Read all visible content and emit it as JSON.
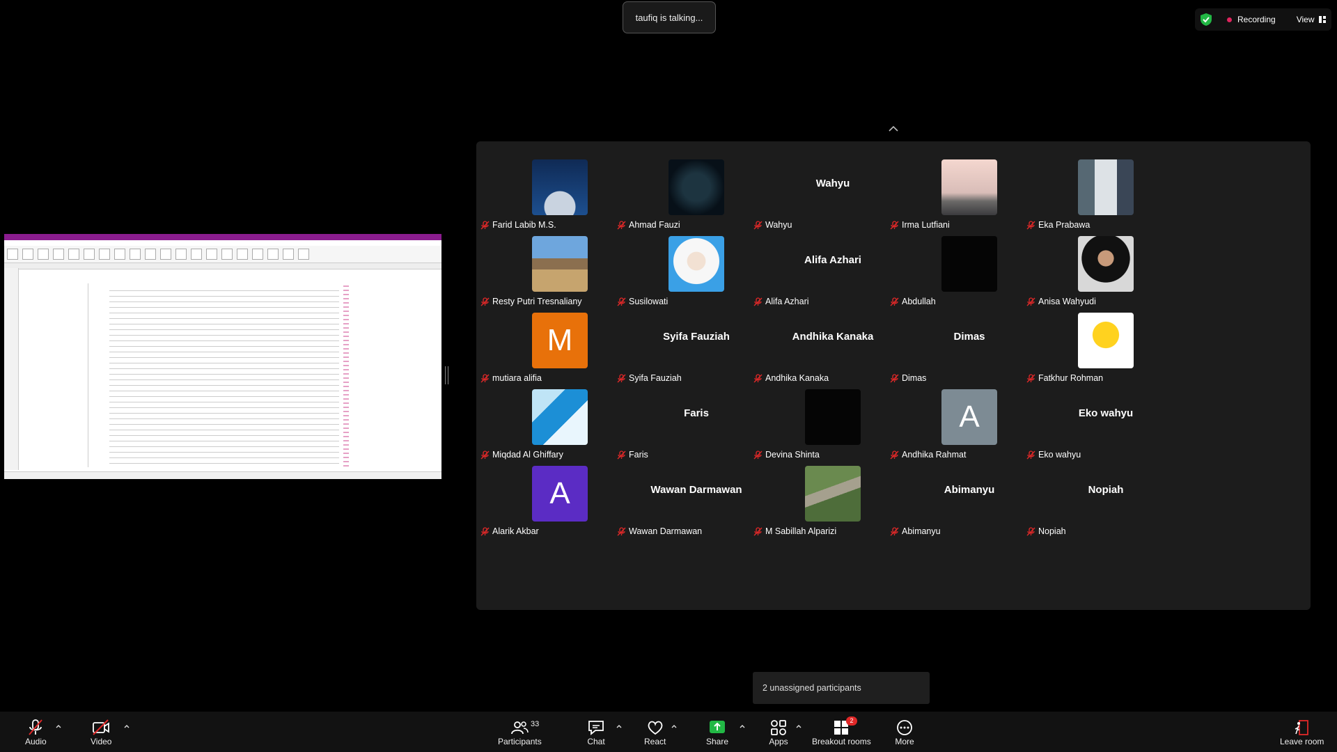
{
  "talking": "taufiq is talking...",
  "recording": {
    "label": "Recording",
    "view": "View"
  },
  "gallery": {
    "tiles": [
      {
        "name": "Farid Labib M.S.",
        "avatar": "photo-moon",
        "big": ""
      },
      {
        "name": "Ahmad Fauzi",
        "avatar": "photo-anime",
        "big": ""
      },
      {
        "name": "Wahyu",
        "avatar": "",
        "big": "Wahyu"
      },
      {
        "name": "Irma Lutfiani",
        "avatar": "photo-sky",
        "big": ""
      },
      {
        "name": "Eka Prabawa",
        "avatar": "photo-worker",
        "big": ""
      },
      {
        "name": "Resty Putri Tresnaliany",
        "avatar": "photo-field",
        "big": ""
      },
      {
        "name": "Susilowati",
        "avatar": "photo-hijab",
        "big": ""
      },
      {
        "name": "Alifa Azhari",
        "avatar": "",
        "big": "Alifa Azhari"
      },
      {
        "name": "Abdullah",
        "avatar": "photo-dark",
        "big": ""
      },
      {
        "name": "Anisa Wahyudi",
        "avatar": "photo-hijab-dark",
        "big": ""
      },
      {
        "name": "mutiara alifia",
        "avatar": "letter",
        "letter": "M",
        "color": "#e8710a",
        "big": ""
      },
      {
        "name": "Syifa Fauziah",
        "avatar": "",
        "big": "Syifa Fauziah"
      },
      {
        "name": "Andhika Kanaka",
        "avatar": "",
        "big": "Andhika Kanaka"
      },
      {
        "name": "Dimas",
        "avatar": "",
        "big": "Dimas"
      },
      {
        "name": "Fatkhur Rohman",
        "avatar": "photo-emoji",
        "big": ""
      },
      {
        "name": "Miqdad Al Ghiffary",
        "avatar": "photo-blue",
        "big": ""
      },
      {
        "name": "Faris",
        "avatar": "",
        "big": "Faris"
      },
      {
        "name": "Devina Shinta",
        "avatar": "photo-dark",
        "big": ""
      },
      {
        "name": "Andhika Rahmat",
        "avatar": "letter",
        "letter": "A",
        "color": "#7d8b94",
        "big": ""
      },
      {
        "name": "Eko wahyu",
        "avatar": "",
        "big": "Eko wahyu"
      },
      {
        "name": "Alarik Akbar",
        "avatar": "letter",
        "letter": "A",
        "color": "#5b2cc4",
        "big": ""
      },
      {
        "name": "Wawan Darmawan",
        "avatar": "",
        "big": "Wawan Darmawan"
      },
      {
        "name": "M Sabillah Alparizi",
        "avatar": "photo-road",
        "big": ""
      },
      {
        "name": "Abimanyu",
        "avatar": "",
        "big": "Abimanyu"
      },
      {
        "name": "Nopiah",
        "avatar": "",
        "big": "Nopiah"
      }
    ]
  },
  "unassigned": "2 unassigned participants",
  "toolbar": {
    "audio": "Audio",
    "video": "Video",
    "participants": "Participants",
    "participants_count": "33",
    "chat": "Chat",
    "react": "React",
    "share": "Share",
    "apps": "Apps",
    "breakout": "Breakout rooms",
    "breakout_badge": "2",
    "more": "More",
    "leave": "Leave room"
  },
  "colors": {
    "accent_green": "#22b845",
    "muted_red": "#e02828",
    "panel": "#1c1c1c"
  }
}
